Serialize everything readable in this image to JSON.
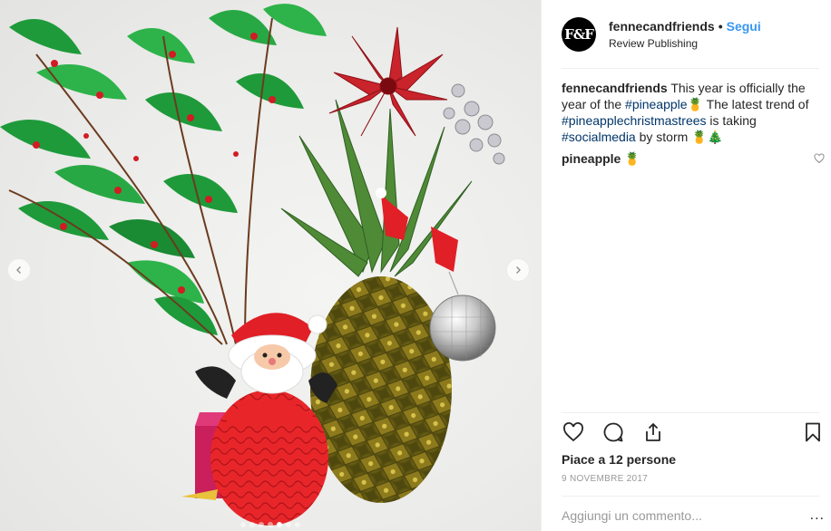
{
  "post": {
    "username": "fennecandfriends",
    "separator": "•",
    "follow_label": "Segui",
    "subtitle": "Review Publishing",
    "avatar_text": "F&F",
    "caption": {
      "text_1": "This year is officially the year of the",
      "tag_1": "#pineapple",
      "emoji_1": "🍍",
      "text_2": "The latest trend of",
      "tag_2": "#pineapplechristmastrees",
      "text_3": "is taking",
      "tag_3": "#socialmedia",
      "text_4": "by storm",
      "emoji_2": "🍍🎄"
    },
    "comment": {
      "text": "pineapple",
      "emoji": "🍍"
    },
    "likes": "Piace a 12 persone",
    "date": "9 NOVEMBRE 2017",
    "comment_placeholder": "Aggiungi un commento...",
    "more_label": "..."
  },
  "carousel": {
    "total_slides": 7,
    "active_slide": 5
  },
  "icons": {
    "prev": "chevron-left-icon",
    "next": "chevron-right-icon",
    "like": "heart-icon",
    "comment": "comment-icon",
    "share": "share-icon",
    "save": "bookmark-icon",
    "comment_like": "small-heart-icon"
  },
  "colors": {
    "link_blue": "#3897f0",
    "hashtag": "#003569",
    "muted": "#999999",
    "text": "#262626"
  }
}
